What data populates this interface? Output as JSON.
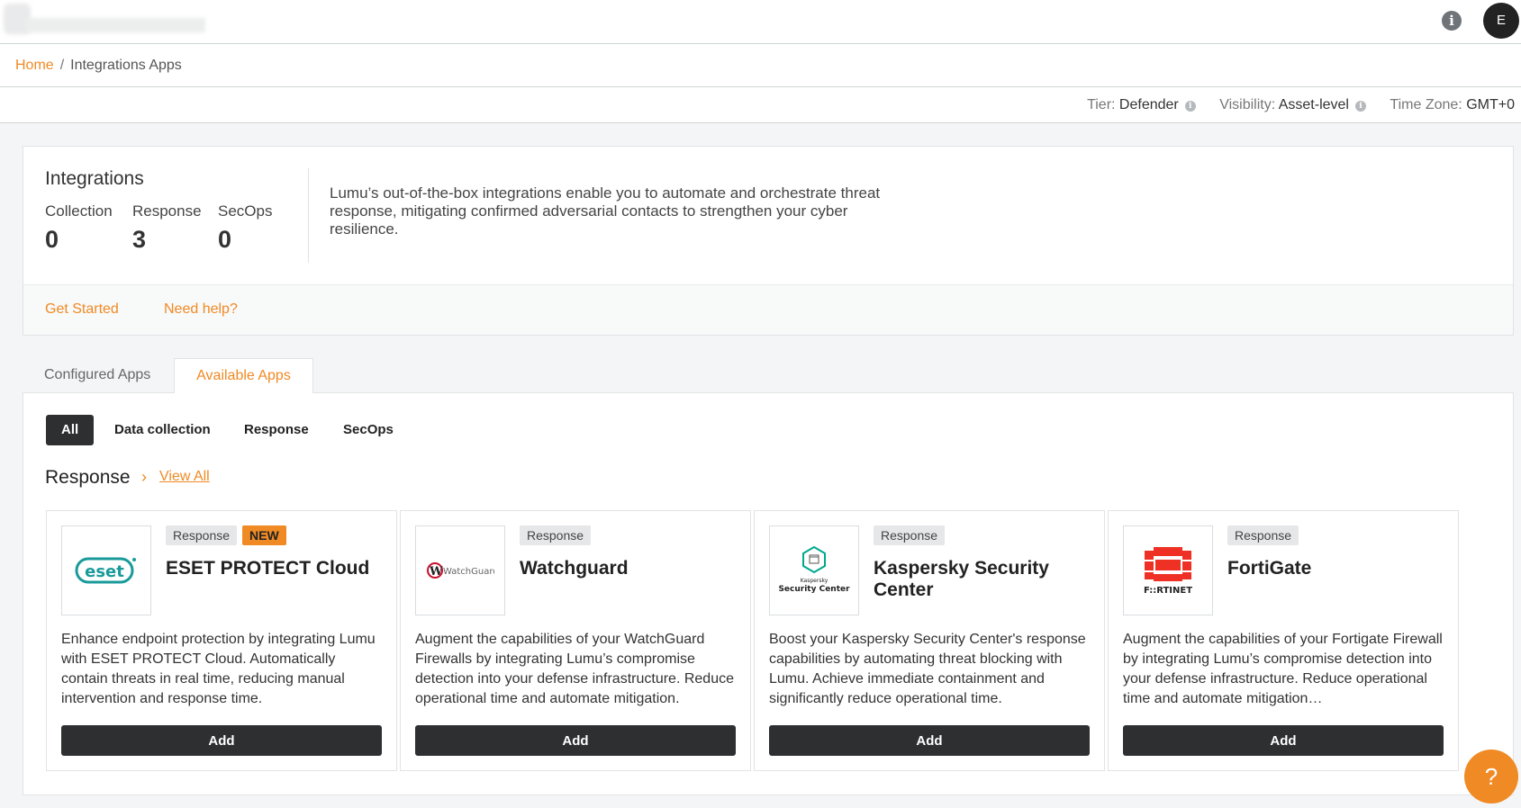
{
  "topbar": {
    "avatar_initial": "E"
  },
  "breadcrumb": {
    "home": "Home",
    "separator": "/",
    "current": "Integrations Apps"
  },
  "meta": {
    "tier_label": "Tier:",
    "tier_value": "Defender",
    "visibility_label": "Visibility:",
    "visibility_value": "Asset-level",
    "timezone_label": "Time Zone:",
    "timezone_value": "GMT+0"
  },
  "integrations": {
    "title": "Integrations",
    "stats": [
      {
        "label": "Collection",
        "value": "0"
      },
      {
        "label": "Response",
        "value": "3"
      },
      {
        "label": "SecOps",
        "value": "0"
      }
    ],
    "description": "Lumu’s out-of-the-box integrations enable you to automate and orchestrate threat response, mitigating confirmed adversarial contacts to strengthen your cyber resilience.",
    "get_started": "Get Started",
    "need_help": "Need help?"
  },
  "tabs": [
    {
      "label": "Configured Apps"
    },
    {
      "label": "Available Apps"
    }
  ],
  "filters": [
    "All",
    "Data collection",
    "Response",
    "SecOps"
  ],
  "section": {
    "title": "Response",
    "chevron": "›",
    "view_all": "View All"
  },
  "cards": [
    {
      "badges": [
        "Response"
      ],
      "new_badge": "NEW",
      "title": "ESET PROTECT Cloud",
      "description": "Enhance endpoint protection by integrating Lumu with ESET PROTECT Cloud. Automatically contain threats in real time, reducing manual intervention and response time.",
      "button": "Add",
      "logo": "eset"
    },
    {
      "badges": [
        "Response"
      ],
      "title": "Watchguard",
      "description": "Augment the capabilities of your WatchGuard Firewalls by integrating Lumu’s compromise detection into your defense infrastructure. Reduce operational time and automate mitigation.",
      "button": "Add",
      "logo": "WatchGuard"
    },
    {
      "badges": [
        "Response"
      ],
      "title": "Kaspersky Security Center",
      "description": "Boost your Kaspersky Security Center's response capabilities by automating threat blocking with Lumu. Achieve immediate containment and significantly reduce operational time.",
      "button": "Add",
      "logo_line1": "Kaspersky",
      "logo_line2": "Security Center"
    },
    {
      "badges": [
        "Response"
      ],
      "title": "FortiGate",
      "description": "Augment the capabilities of your Fortigate Firewall by integrating Lumu’s compromise detection into your defense infrastructure. Reduce operational time and automate mitigation…",
      "button": "Add",
      "logo": "F::RTINET"
    }
  ],
  "icons": {
    "info": "info-icon",
    "help": "help-icon",
    "brand_color": "#f08a24"
  }
}
